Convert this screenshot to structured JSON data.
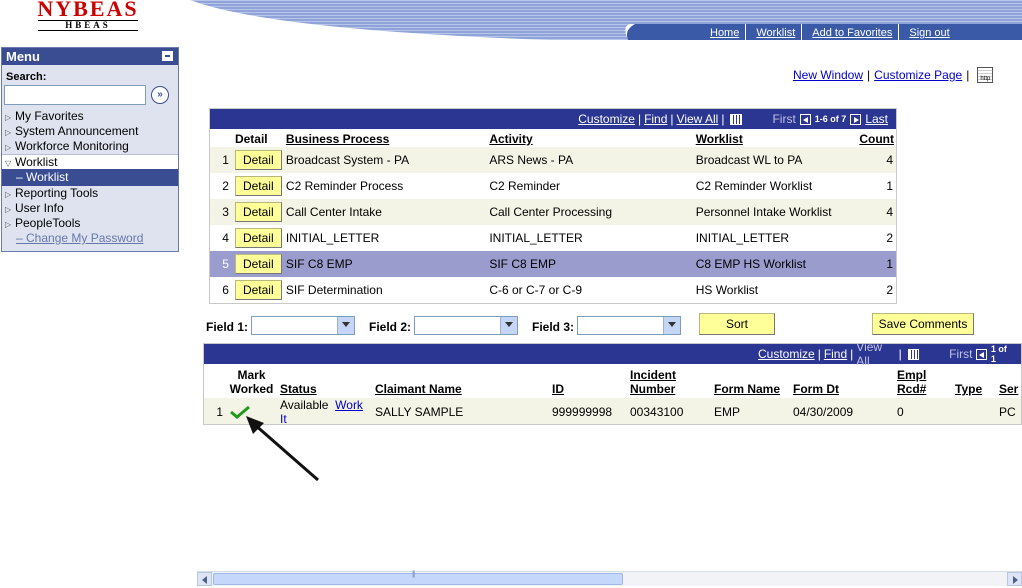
{
  "logo": {
    "line1": "NYBEAS",
    "line2": "HBEAS"
  },
  "toplinks": [
    "Home",
    "Worklist",
    "Add to Favorites",
    "Sign out"
  ],
  "menu": {
    "title": "Menu",
    "search_label": "Search:",
    "search_value": "",
    "items": [
      {
        "label": "My Favorites",
        "state": "collapsed"
      },
      {
        "label": "System Announcement",
        "state": "collapsed"
      },
      {
        "label": "Workforce Monitoring",
        "state": "collapsed"
      },
      {
        "label": "Worklist",
        "state": "expanded"
      },
      {
        "label": "– Worklist",
        "state": "selected"
      },
      {
        "label": "Reporting Tools",
        "state": "collapsed"
      },
      {
        "label": "User Info",
        "state": "collapsed"
      },
      {
        "label": "PeopleTools",
        "state": "collapsed"
      },
      {
        "label": "– Change My Password",
        "state": "link"
      }
    ]
  },
  "page_links": {
    "new_window": "New Window",
    "customize_page": "Customize Page",
    "sep": "|"
  },
  "grid1": {
    "nav": {
      "customize": "Customize",
      "find": "Find",
      "view_all": "View All",
      "first": "First",
      "range": "1-6 of 7",
      "last": "Last"
    },
    "headers": {
      "detail": "Detail",
      "business_process": "Business Process",
      "activity": "Activity",
      "worklist": "Worklist",
      "count": "Count"
    },
    "rows": [
      {
        "num": "1",
        "detail": "Detail",
        "bp": "Broadcast System - PA",
        "activity": "ARS News - PA",
        "worklist": "Broadcast WL to PA",
        "count": "4"
      },
      {
        "num": "2",
        "detail": "Detail",
        "bp": "C2 Reminder Process",
        "activity": "C2 Reminder",
        "worklist": "C2 Reminder Worklist",
        "count": "1"
      },
      {
        "num": "3",
        "detail": "Detail",
        "bp": "Call Center Intake",
        "activity": "Call Center Processing",
        "worklist": "Personnel Intake Worklist",
        "count": "4"
      },
      {
        "num": "4",
        "detail": "Detail",
        "bp": "INITIAL_LETTER",
        "activity": "INITIAL_LETTER",
        "worklist": "INITIAL_LETTER",
        "count": "2"
      },
      {
        "num": "5",
        "detail": "Detail",
        "bp": "SIF C8 EMP",
        "activity": "SIF C8 EMP",
        "worklist": "C8 EMP HS Worklist",
        "count": "1"
      },
      {
        "num": "6",
        "detail": "Detail",
        "bp": "SIF Determination",
        "activity": "C-6 or C-7 or C-9",
        "worklist": "HS Worklist",
        "count": "2"
      }
    ]
  },
  "fields": {
    "field1_label": "Field 1:",
    "field1_value": "",
    "field2_label": "Field 2:",
    "field2_value": "",
    "field3_label": "Field 3:",
    "field3_value": "",
    "sort": "Sort",
    "save_comments": "Save Comments"
  },
  "grid2": {
    "nav": {
      "customize": "Customize",
      "find": "Find",
      "view_all": "View All",
      "first": "First",
      "range": "1 of 1"
    },
    "headers": {
      "mark_worked_1": "Mark",
      "mark_worked_2": "Worked",
      "status": "Status",
      "claimant": "Claimant Name",
      "id": "ID",
      "incident_1": "Incident",
      "incident_2": "Number",
      "form_name": "Form Name",
      "form_dt": "Form Dt",
      "empl_1": "Empl",
      "empl_2": "Rcd#",
      "type": "Type",
      "ser": "Ser"
    },
    "rows": [
      {
        "num": "1",
        "status": "Available",
        "work_it": "Work It",
        "claimant": "SALLY SAMPLE",
        "id": "999999998",
        "incident": "00343100",
        "form_name": "EMP",
        "form_dt": "04/30/2009",
        "empl": "0",
        "type": "",
        "ser": "PC"
      }
    ]
  },
  "colors": {
    "nav_blue": "#2b3592",
    "menu_blue": "#3a4d93",
    "button_yellow": "#ffff99",
    "highlight_row": "#9a9ccd"
  }
}
